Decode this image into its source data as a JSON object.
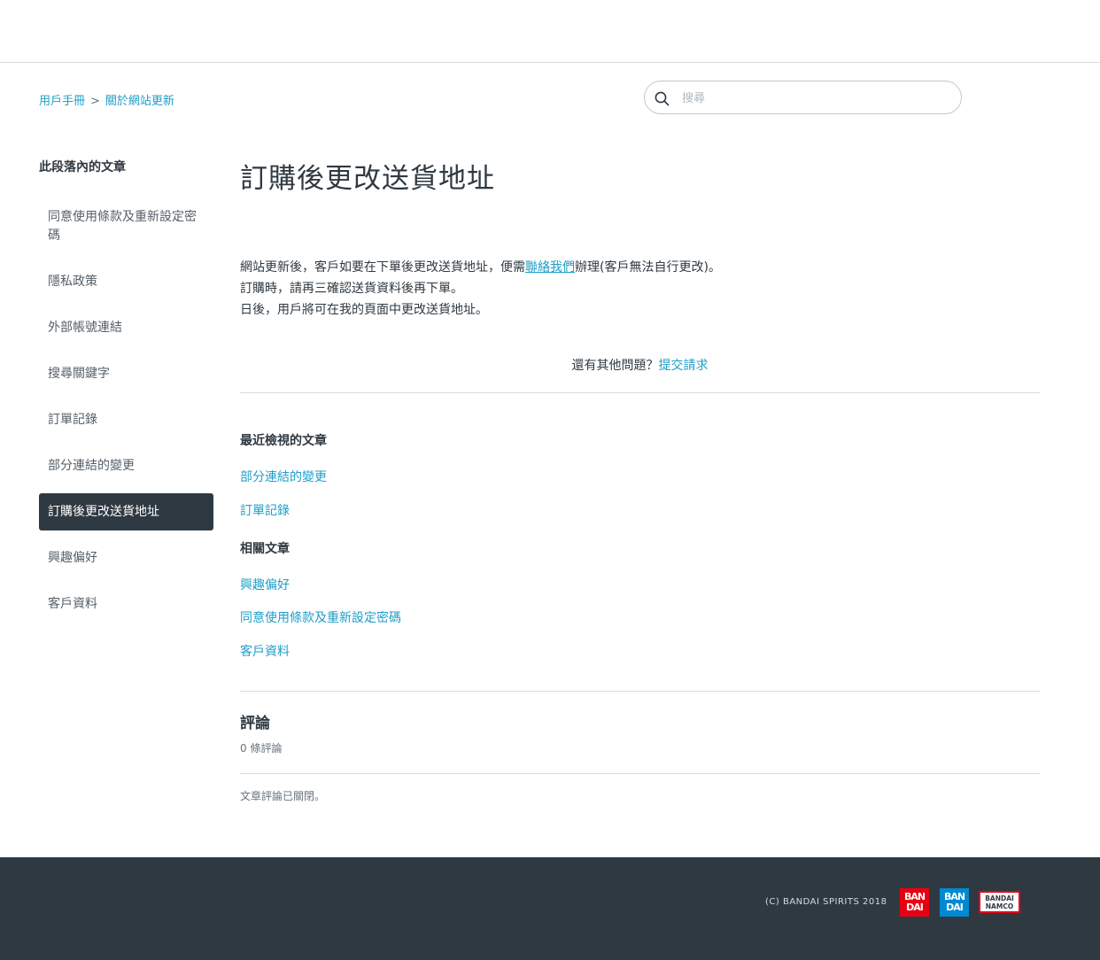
{
  "breadcrumb": {
    "items": [
      "用戶手冊",
      "關於網站更新"
    ],
    "separator": ">"
  },
  "search": {
    "placeholder": "搜尋",
    "icon": "search-icon"
  },
  "sidebar": {
    "title": "此段落內的文章",
    "items": [
      {
        "label": "同意使用條款及重新設定密碼"
      },
      {
        "label": "隱私政策"
      },
      {
        "label": "外部帳號連結"
      },
      {
        "label": "搜尋關鍵字"
      },
      {
        "label": "訂單記錄"
      },
      {
        "label": "部分連結的變更"
      },
      {
        "label": "訂購後更改送貨地址",
        "current": true
      },
      {
        "label": "興趣偏好"
      },
      {
        "label": "客戶資料"
      }
    ]
  },
  "article": {
    "title": "訂購後更改送貨地址",
    "p1_before": "網站更新後，客戶如要在下單後更改送貨地址，便需",
    "p1_link": "聯絡我們",
    "p1_after": "辦理(客戶無法自行更改)。",
    "p2": "訂購時，請再三確認送貨資料後再下單。",
    "p3": "日後，用戶將可在我的頁面中更改送貨地址。"
  },
  "more_questions": {
    "text": "還有其他問題？",
    "link": "提交請求"
  },
  "recent": {
    "title": "最近檢視的文章",
    "items": [
      "部分連結的變更",
      "訂單記錄"
    ]
  },
  "related": {
    "title": "相關文章",
    "items": [
      "興趣偏好",
      "同意使用條款及重新設定密碼",
      "客戶資料"
    ]
  },
  "comments": {
    "title": "評論",
    "count": "0 條評論",
    "closed": "文章評論已關閉。"
  },
  "footer": {
    "copyright": "(C) BANDAI SPIRITS 2018",
    "logos": [
      {
        "line1": "BAN",
        "line2": "DAI",
        "color": "#e60012"
      },
      {
        "line1": "BAN",
        "line2": "DAI",
        "color": "#0089d0"
      },
      {
        "line1": "BANDAI",
        "line2": "NAMCO",
        "color": "#e60012"
      }
    ]
  },
  "colors": {
    "link": "#1f9ec9",
    "text": "#2f3941",
    "footer_bg": "#2f3941",
    "current_item_bg": "#2f3941"
  }
}
